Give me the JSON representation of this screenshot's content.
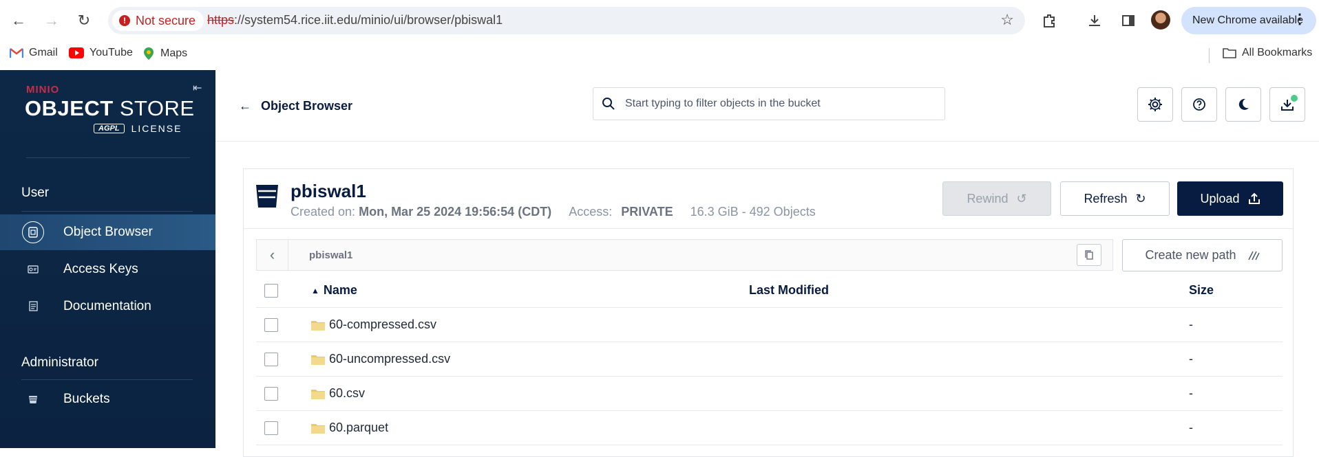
{
  "browser": {
    "not_secure_label": "Not secure",
    "url_scheme": "https",
    "url_rest": "://system54.rice.iit.edu/minio/ui/browser/pbiswal1",
    "update_label": "New Chrome available",
    "bookmarks": [
      {
        "label": "Gmail",
        "icon": "gmail-icon"
      },
      {
        "label": "YouTube",
        "icon": "youtube-icon"
      },
      {
        "label": "Maps",
        "icon": "maps-icon"
      }
    ],
    "all_bookmarks_label": "All Bookmarks"
  },
  "sidebar": {
    "logo": {
      "brand": "MINIO",
      "product_bold": "OBJECT",
      "product": " STORE",
      "badge": "AGPL",
      "license": "LICENSE"
    },
    "user_section": "User",
    "user_items": [
      {
        "label": "Object Browser",
        "icon": "object-browser-icon",
        "active": true
      },
      {
        "label": "Access Keys",
        "icon": "access-keys-icon",
        "active": false
      },
      {
        "label": "Documentation",
        "icon": "documentation-icon",
        "active": false
      }
    ],
    "admin_section": "Administrator",
    "admin_items": [
      {
        "label": "Buckets",
        "icon": "buckets-icon",
        "active": false
      }
    ]
  },
  "header": {
    "back_label": "Object Browser",
    "search_placeholder": "Start typing to filter objects in the bucket",
    "actions": [
      "settings-icon",
      "help-icon",
      "dark-mode-icon",
      "downloads-icon"
    ]
  },
  "bucket": {
    "name": "pbiswal1",
    "created_label": "Created on:",
    "created_value": "Mon, Mar 25 2024 19:56:54 (CDT)",
    "access_label": "Access:",
    "access_value": "PRIVATE",
    "usage": "16.3 GiB - 492 Objects",
    "rewind_label": "Rewind",
    "refresh_label": "Refresh",
    "upload_label": "Upload",
    "path": "pbiswal1",
    "create_path_label": "Create new path"
  },
  "table": {
    "columns": {
      "name": "Name",
      "modified": "Last Modified",
      "size": "Size"
    },
    "rows": [
      {
        "name": "60-compressed.csv",
        "modified": "",
        "size": "-"
      },
      {
        "name": "60-uncompressed.csv",
        "modified": "",
        "size": "-"
      },
      {
        "name": "60.csv",
        "modified": "",
        "size": "-"
      },
      {
        "name": "60.parquet",
        "modified": "",
        "size": "-"
      }
    ]
  },
  "colors": {
    "sidebar_bg": "#0d2847",
    "primary": "#081c42",
    "brand_red": "#c72c48",
    "insecure_red": "#c5221f"
  }
}
